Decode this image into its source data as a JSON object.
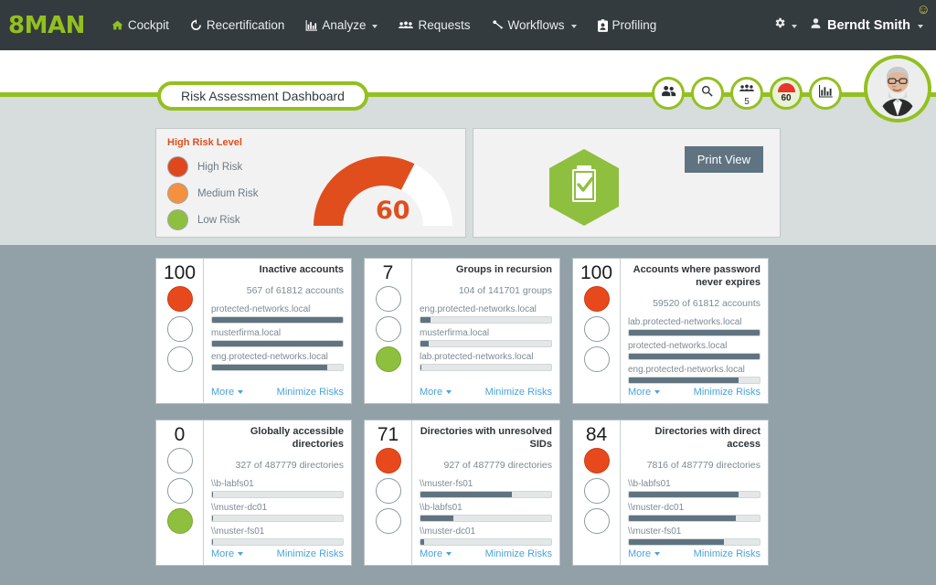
{
  "brand": {
    "logo": "8MAN",
    "green": "#93c01f",
    "dark": "#333b3f"
  },
  "nav": {
    "items": [
      {
        "label": "Cockpit",
        "icon": "home-icon",
        "active": true,
        "caret": false
      },
      {
        "label": "Recertification",
        "icon": "recert-icon",
        "active": false,
        "caret": false
      },
      {
        "label": "Analyze",
        "icon": "analyze-icon",
        "active": false,
        "caret": true
      },
      {
        "label": "Requests",
        "icon": "requests-icon",
        "active": false,
        "caret": false
      },
      {
        "label": "Workflows",
        "icon": "workflows-icon",
        "active": false,
        "caret": true
      },
      {
        "label": "Profiling",
        "icon": "profiling-icon",
        "active": false,
        "caret": false
      }
    ],
    "settings_icon": "gear-icon",
    "user": "Berndt Smith",
    "status_icon": "smiley-icon",
    "status_glyph": "☺"
  },
  "page": {
    "title": "Risk Assessment Dashboard",
    "badges": [
      {
        "name": "users-badge",
        "icon": "users-icon",
        "value": ""
      },
      {
        "name": "search-badge",
        "icon": "search-icon",
        "value": ""
      },
      {
        "name": "groups-badge",
        "icon": "groups-icon",
        "value": "5"
      },
      {
        "name": "risk-gauge-badge",
        "icon": "gauge-icon",
        "value": "60"
      },
      {
        "name": "report-badge",
        "icon": "chart-icon",
        "value": ""
      }
    ]
  },
  "risk_panel": {
    "title": "High Risk Level",
    "legend": [
      {
        "label": "High Risk",
        "color": "#e0471d"
      },
      {
        "label": "Medium Risk",
        "color": "#f5913e"
      },
      {
        "label": "Low Risk",
        "color": "#8fbf3e"
      }
    ],
    "gauge_value": "60",
    "gauge_percent": 65,
    "gauge_fill_color": "#e04e1e",
    "gauge_track_color": "#ffffff"
  },
  "print_panel": {
    "icon": "clipboard-check-icon",
    "button_label": "Print View"
  },
  "cards": [
    {
      "score": "100",
      "light": "red",
      "title": "Inactive accounts",
      "subtitle": "567 of 61812 accounts",
      "bars": [
        {
          "label": "protected-networks.local",
          "percent": 100
        },
        {
          "label": "musterfirma.local",
          "percent": 100
        },
        {
          "label": "eng.protected-networks.local",
          "percent": 88
        }
      ],
      "more_label": "More",
      "minimize_label": "Minimize Risks"
    },
    {
      "score": "7",
      "light": "green",
      "title": "Groups in recursion",
      "subtitle": "104 of 141701 groups",
      "bars": [
        {
          "label": "eng.protected-networks.local",
          "percent": 8
        },
        {
          "label": "musterfirma.local",
          "percent": 6
        },
        {
          "label": "lab.protected-networks.local",
          "percent": 1
        }
      ],
      "more_label": "More",
      "minimize_label": "Minimize Risks"
    },
    {
      "score": "100",
      "light": "red",
      "title": "Accounts where password never expires",
      "subtitle": "59520 of 61812 accounts",
      "bars": [
        {
          "label": "lab.protected-networks.local",
          "percent": 100
        },
        {
          "label": "protected-networks.local",
          "percent": 100
        },
        {
          "label": "eng.protected-networks.local",
          "percent": 84
        }
      ],
      "more_label": "More",
      "minimize_label": "Minimize Risks"
    },
    {
      "score": "0",
      "light": "green",
      "title": "Globally accessible directories",
      "subtitle": "327 of 487779 directories",
      "bars": [
        {
          "label": "\\\\b-labfs01",
          "percent": 1
        },
        {
          "label": "\\\\muster-dc01",
          "percent": 1
        },
        {
          "label": "\\\\muster-fs01",
          "percent": 1
        }
      ],
      "more_label": "More",
      "minimize_label": "Minimize Risks"
    },
    {
      "score": "71",
      "light": "red",
      "title": "Directories with unresolved SIDs",
      "subtitle": "927 of 487779 directories",
      "bars": [
        {
          "label": "\\\\muster-fs01",
          "percent": 70
        },
        {
          "label": "\\\\b-labfs01",
          "percent": 25
        },
        {
          "label": "\\\\muster-dc01",
          "percent": 3
        }
      ],
      "more_label": "More",
      "minimize_label": "Minimize Risks"
    },
    {
      "score": "84",
      "light": "red",
      "title": "Directories with direct access",
      "subtitle": "7816 of 487779 directories",
      "bars": [
        {
          "label": "\\\\b-labfs01",
          "percent": 84
        },
        {
          "label": "\\\\muster-dc01",
          "percent": 82
        },
        {
          "label": "\\\\muster-fs01",
          "percent": 73
        }
      ],
      "more_label": "More",
      "minimize_label": "Minimize Risks"
    }
  ]
}
